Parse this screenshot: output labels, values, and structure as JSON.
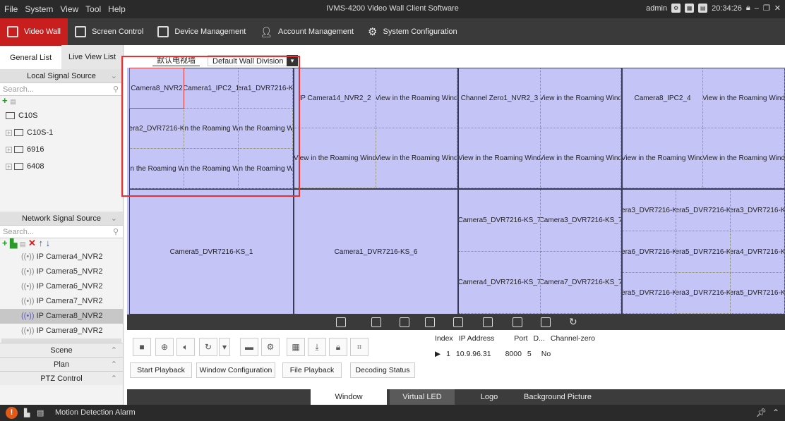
{
  "titlebar": {
    "menu": [
      "File",
      "System",
      "View",
      "Tool",
      "Help"
    ],
    "title": "IVMS-4200 Video Wall Client Software",
    "user": "admin",
    "time": "20:34:26"
  },
  "nav": [
    {
      "label": "Video Wall",
      "active": true
    },
    {
      "label": "Screen Control"
    },
    {
      "label": "Device Management"
    },
    {
      "label": "Account Management"
    },
    {
      "label": "System Configuration"
    }
  ],
  "left": {
    "tabs": [
      "General List",
      "Live View List"
    ],
    "local_header": "Local Signal Source",
    "search_placeholder": "Search...",
    "local_items": [
      "C10S",
      "C10S-1",
      "6916",
      "6408"
    ],
    "network_header": "Network Signal Source",
    "network_items": [
      "IP Camera4_NVR2",
      "IP Camera5_NVR2",
      "IP Camera6_NVR2",
      "IP Camera7_NVR2",
      "IP Camera8_NVR2",
      "IP Camera9_NVR2"
    ],
    "sections": [
      "Scene",
      "Plan",
      "PTZ Control"
    ]
  },
  "wall": {
    "tabs": [
      "默认电视墙",
      "Default Wall Division"
    ],
    "cells": {
      "r1": [
        "Camera8_NVR2",
        "Camera1_IPC2_1",
        "era1_DVR7216-K",
        "IP Camera14_NVR2_2",
        "View in the Roaming Wind",
        "Channel Zero1_NVR2_3",
        "View in the Roaming Wind",
        "Camera8_IPC2_4",
        "View in the Roaming Wind"
      ],
      "r2": [
        "era2_DVR7216-K",
        "in the Roaming W",
        "in the Roaming W"
      ],
      "r3a": [
        "in the Roaming W",
        "in the Roaming W",
        "in the Roaming W"
      ],
      "r3b": [
        "View in the Roaming Wind",
        "View in the Roaming Wind",
        "View in the Roaming Wind",
        "View in the Roaming Wind",
        "View in the Roaming Wind",
        "View in the Roaming Wind"
      ],
      "big1": "Camera5_DVR7216-KS_1",
      "big2": "Camera1_DVR7216-KS_6",
      "mid": [
        "Camera5_DVR7216-KS_7",
        "Camera3_DVR7216-KS_7",
        "Camera4_DVR7216-KS_7",
        "Camera7_DVR7216-KS_7"
      ],
      "right": [
        "era3_DVR7216-K",
        "era5_DVR7216-K",
        "era3_DVR7216-K",
        "era6_DVR7216-K",
        "era5_DVR7216-K",
        "era4_DVR7216-K",
        "era5_DVR7216-K",
        "era3_DVR7216-K",
        "era5_DVR7216-K"
      ]
    }
  },
  "panel": {
    "buttons": [
      "Start Playback",
      "Window Configuration",
      "File Playback",
      "Decoding Status"
    ],
    "table_headers": [
      "Index",
      "IP Address",
      "Port",
      "D...",
      "Channel-zero"
    ],
    "table_row": [
      "1",
      "10.9.96.31",
      "8000",
      "5",
      "No"
    ]
  },
  "bottom_tabs": [
    "Window",
    "Virtual LED",
    "Logo",
    "Background Picture"
  ],
  "status": {
    "alarm": "Motion Detection Alarm"
  }
}
